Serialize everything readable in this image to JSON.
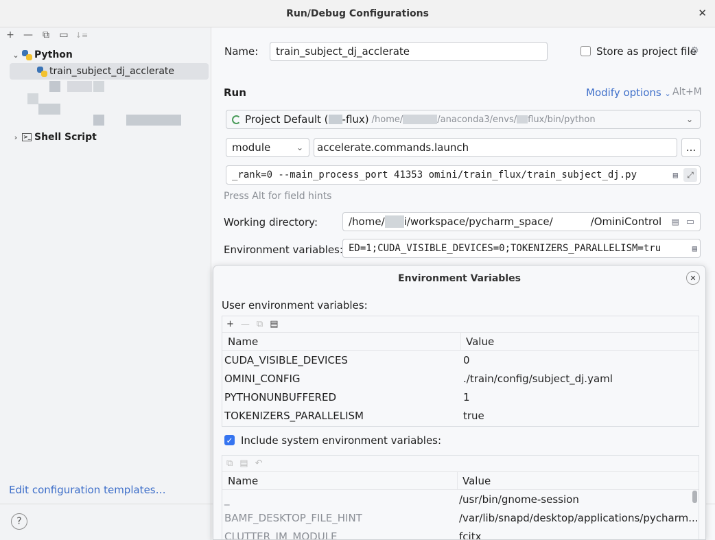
{
  "window": {
    "title": "Run/Debug Configurations",
    "close_glyph": "✕"
  },
  "left_toolbar": {
    "add": "+",
    "remove": "—",
    "copy": "⧉",
    "folder": "▭",
    "sort": "↓≡"
  },
  "tree": {
    "python_group": "Python",
    "python_item": "train_subject_dj_acclerate",
    "shell_group": "Shell Script",
    "shell_glyph": ">_"
  },
  "edit_templates": "Edit configuration templates…",
  "help_glyph": "?",
  "form": {
    "name_label": "Name:",
    "name_value": "train_subject_dj_acclerate",
    "store_label": "Store as project file",
    "run_section": "Run",
    "modify_options": "Modify options",
    "modify_shortcut": "Alt+M",
    "interpreter_main": "Project Default (",
    "interpreter_env": "-flux)",
    "interpreter_path1": "/home/",
    "interpreter_path2": "/anaconda3/envs/",
    "interpreter_path3": "flux/bin/python",
    "module_select": "module",
    "module_value": "accelerate.commands.launch",
    "more_button": "...",
    "params_value": "_rank=0 --main_process_port 41353 omini/train_flux/train_subject_dj.py",
    "field_hint": "Press Alt for field hints",
    "workdir_label": "Working directory:",
    "workdir_part1": "/home/",
    "workdir_part2": "i/workspace/pycharm_space/",
    "workdir_part3": "/OminiControl",
    "env_label": "Environment variables:",
    "env_value": "ED=1;CUDA_VISIBLE_DEVICES=0;TOKENIZERS_PARALLELISM=tru"
  },
  "env_dialog": {
    "title": "Environment Variables",
    "user_label": "User environment variables:",
    "col_name": "Name",
    "col_value": "Value",
    "user_vars": [
      {
        "name": "CUDA_VISIBLE_DEVICES",
        "value": "0"
      },
      {
        "name": "OMINI_CONFIG",
        "value": "./train/config/subject_dj.yaml"
      },
      {
        "name": "PYTHONUNBUFFERED",
        "value": "1"
      },
      {
        "name": "TOKENIZERS_PARALLELISM",
        "value": "true"
      }
    ],
    "include_system_label": "Include system environment variables:",
    "system_vars": [
      {
        "name": "_",
        "value": "/usr/bin/gnome-session"
      },
      {
        "name": "BAMF_DESKTOP_FILE_HINT",
        "value": "/var/lib/snapd/desktop/applications/pycharm..."
      },
      {
        "name": "CLUTTER_IM_MODULE",
        "value": "fcitx"
      }
    ]
  }
}
